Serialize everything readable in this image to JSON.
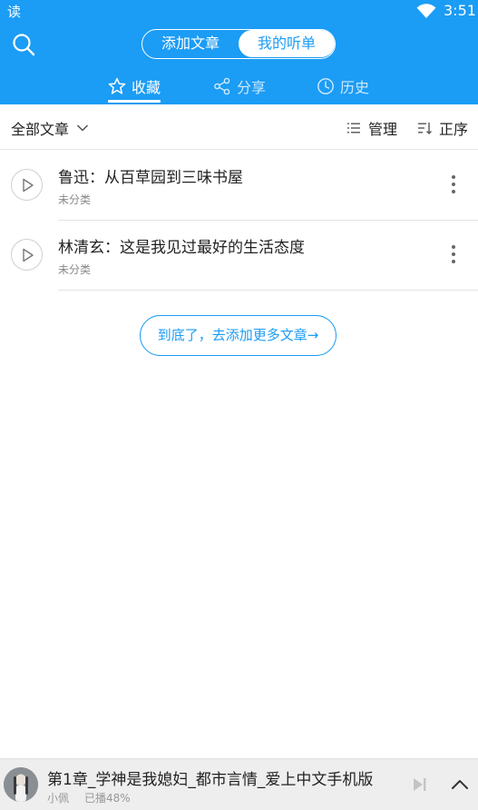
{
  "status_bar": {
    "app_label": "读",
    "time": "3:51"
  },
  "header": {
    "segments": {
      "add_article": "添加文章",
      "my_playlist": "我的听单"
    },
    "tabs": {
      "favorites": "收藏",
      "share": "分享",
      "history": "历史"
    },
    "active_tab": "favorites"
  },
  "toolbar": {
    "filter_label": "全部文章",
    "manage_label": "管理",
    "order_label": "正序"
  },
  "articles": [
    {
      "title": "鲁迅：从百草园到三味书屋",
      "category": "未分类"
    },
    {
      "title": "林清玄：这是我见过最好的生活态度",
      "category": "未分类"
    }
  ],
  "add_more_label": "到底了，去添加更多文章→",
  "player": {
    "title": "第1章_学神是我媳妇_都市言情_爱上中文手机版",
    "author": "小佩",
    "progress": "已播48%"
  },
  "colors": {
    "accent": "#1b9cf5",
    "player_bg": "#eeeeee"
  }
}
